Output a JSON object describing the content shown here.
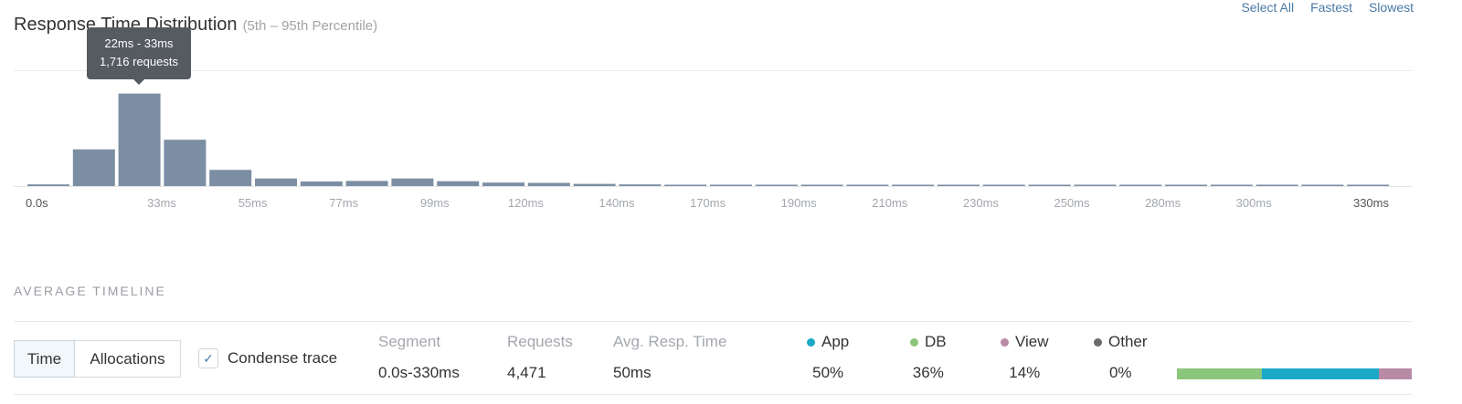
{
  "header": {
    "title": "Response Time Distribution",
    "subtitle": "(5th – 95th Percentile)",
    "links": [
      "Select All",
      "Fastest",
      "Slowest"
    ]
  },
  "tooltip": {
    "range": "22ms - 33ms",
    "requests": "1,716 requests"
  },
  "chart_data": {
    "type": "bar",
    "title": "Response Time Distribution",
    "subtitle": "(5th – 95th Percentile)",
    "x_tick_labels": [
      "0.0s",
      "33ms",
      "55ms",
      "77ms",
      "99ms",
      "120ms",
      "140ms",
      "170ms",
      "190ms",
      "210ms",
      "230ms",
      "250ms",
      "280ms",
      "300ms",
      "330ms"
    ],
    "bar_color": "#7b8ea3",
    "values": [
      30,
      680,
      1716,
      860,
      300,
      140,
      85,
      95,
      140,
      90,
      65,
      60,
      40,
      30,
      25,
      20,
      20,
      20,
      20,
      20,
      20,
      20,
      20,
      20,
      20,
      20,
      20,
      20,
      20,
      20
    ],
    "ylim": [
      0,
      2150
    ],
    "grid": true
  },
  "timeline": {
    "section_label": "AVERAGE TIMELINE",
    "toggle": [
      "Time",
      "Allocations"
    ],
    "active_toggle": "Time",
    "condense_label": "Condense trace",
    "condense_checked": true,
    "stats": [
      {
        "label": "Segment",
        "value": "0.0s-330ms"
      },
      {
        "label": "Requests",
        "value": "4,471"
      },
      {
        "label": "Avg. Resp. Time",
        "value": "50ms"
      }
    ],
    "breakdown": [
      {
        "label": "App",
        "value": "50%",
        "color": "#1aaac8"
      },
      {
        "label": "DB",
        "value": "36%",
        "color": "#8cc57c"
      },
      {
        "label": "View",
        "value": "14%",
        "color": "#b78aa6"
      },
      {
        "label": "Other",
        "value": "0%",
        "color": "#6b6b6b"
      }
    ],
    "stack_order": [
      "DB",
      "App",
      "View"
    ]
  }
}
